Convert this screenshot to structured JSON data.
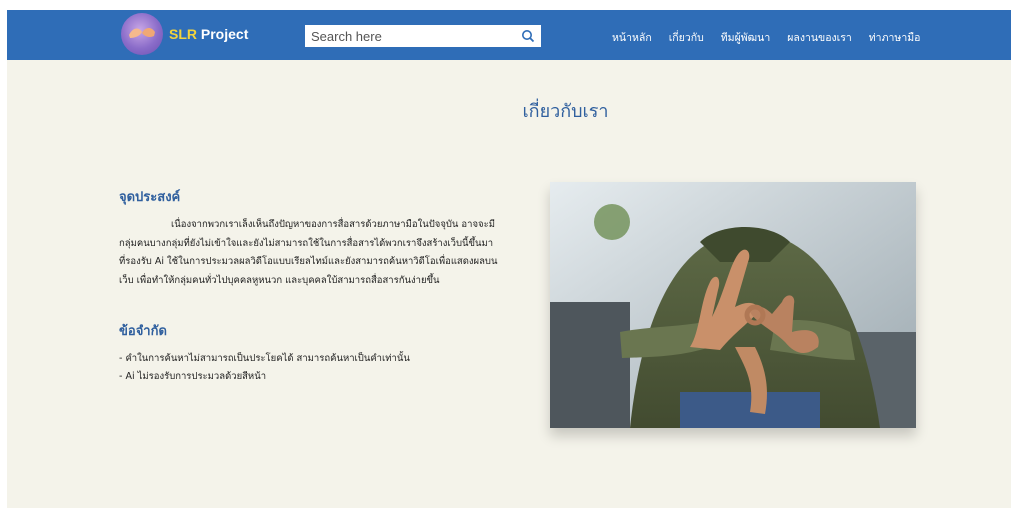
{
  "brand": {
    "highlight": "SLR",
    "rest": " Project"
  },
  "search": {
    "placeholder": "Search here"
  },
  "nav": {
    "items": [
      "หน้าหลัก",
      "เกี่ยวกับ",
      "ทีมผู้พัฒนา",
      "ผลงานของเรา",
      "ท่าภาษามือ"
    ]
  },
  "page": {
    "title": "เกี่ยวกับเรา"
  },
  "purpose": {
    "heading": "จุดประสงค์",
    "text": "เนื่องจากพวกเราเล็งเห็นถึงปัญหาของการสื่อสารด้วยภาษามือในปัจจุบัน อาจจะมีกลุ่มคนบางกลุ่มที่ยังไม่เข้าใจและยังไม่สามารถใช้ในการสื่อสารได้พวกเราจึงสร้างเว็บนี้ขึ้นมา ที่รองรับ Ai ใช้ในการประมวลผลวิดีโอแบบเรียลไทม์และยังสามารถค้นหาวิดีโอเพื่อแสดงผลบนเว็บ เพื่อทำให้กลุ่มคนทั่วไปบุคคลหูหนวก และบุคคลใบ้สามารถสื่อสารกันง่ายขึ้น"
  },
  "limitations": {
    "heading": "ข้อจำกัด",
    "items": [
      "- คำในการค้นหาไม่สามารถเป็นประโยคได้ สามารถค้นหาเป็นคำเท่านั้น",
      "- Ai ไม่รองรับการประมวลด้วยสีหน้า"
    ]
  },
  "colors": {
    "navbar": "#2f6db7",
    "accent": "#f2d33c",
    "heading": "#2f5f9e",
    "background": "#f4f3ea"
  },
  "icons": {
    "search": "search-icon",
    "logo": "hands-logo-icon"
  }
}
